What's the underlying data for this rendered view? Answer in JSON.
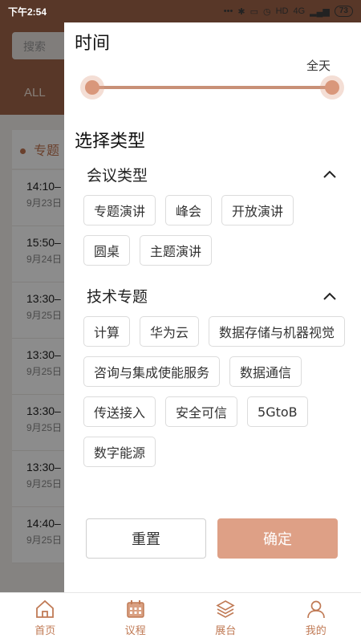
{
  "status_bar": {
    "time": "下午2:54",
    "network": "4G",
    "hd": "HD",
    "battery": "73"
  },
  "background": {
    "search_placeholder": "搜索",
    "all_tab": "ALL",
    "section_label": "专题",
    "items": [
      {
        "time": "14:10–",
        "date": "9月23日"
      },
      {
        "time": "15:50–",
        "date": "9月24日"
      },
      {
        "time": "13:30–",
        "date": "9月25日"
      },
      {
        "time": "13:30–",
        "date": "9月25日"
      },
      {
        "time": "13:30–",
        "date": "9月25日"
      },
      {
        "time": "13:30–",
        "date": "9月25日"
      },
      {
        "time": "14:40–",
        "date": "9月25日"
      }
    ]
  },
  "filter": {
    "time_title": "时间",
    "slider_value_label": "全天",
    "type_title": "选择类型",
    "meeting_type": {
      "title": "会议类型",
      "tags": [
        "专题演讲",
        "峰会",
        "开放演讲",
        "圆桌",
        "主题演讲"
      ]
    },
    "tech_topic": {
      "title": "技术专题",
      "tags": [
        "计算",
        "华为云",
        "数据存储与机器视觉",
        "咨询与集成使能服务",
        "数据通信",
        "传送接入",
        "安全可信",
        "5GtoB",
        "数字能源"
      ]
    },
    "reset_label": "重置",
    "confirm_label": "确定"
  },
  "nav": {
    "items": [
      {
        "label": "首页",
        "icon": "home-icon"
      },
      {
        "label": "议程",
        "icon": "calendar-icon"
      },
      {
        "label": "展台",
        "icon": "layers-icon"
      },
      {
        "label": "我的",
        "icon": "user-icon"
      }
    ]
  },
  "colors": {
    "accent": "#dea086",
    "brand_dark": "#a0644a",
    "nav_text": "#c07a55"
  }
}
